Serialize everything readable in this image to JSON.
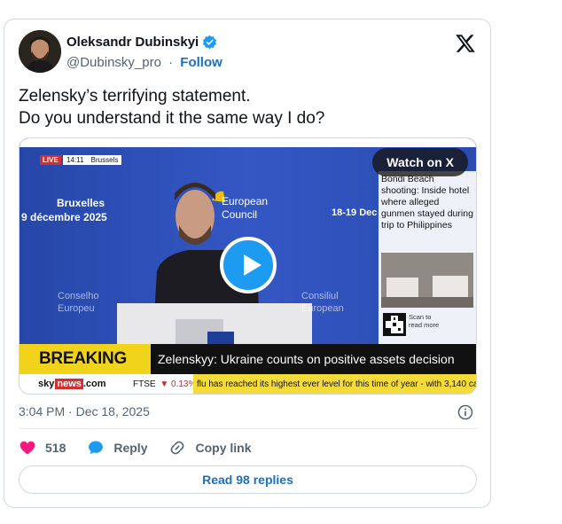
{
  "author": {
    "name": "Oleksandr Dubinskyi",
    "handle": "@Dubinsky_pro",
    "separator": "·",
    "follow_label": "Follow"
  },
  "tweet": {
    "lines": [
      "Zelensky’s terrifying statement.",
      "Do you understand it the same way I do?"
    ],
    "timestamp": "3:04 PM · Dec 18, 2025"
  },
  "media": {
    "watch_label": "Watch on X",
    "live_label": "LIVE",
    "live_time": "14:11",
    "live_location": "Brussels",
    "left_text_1": "Bruxelles",
    "left_text_2": "9 décembre 2025",
    "council_1": "European",
    "council_2": "Council",
    "date_right": "18-19 Dec",
    "consilium_1": "Conselho",
    "consilium_2": "Europeu",
    "consiliul_1": "Consiliul",
    "consiliul_2": "European",
    "side_headline": "Bondi Beach shooting: Inside hotel where alleged gunmen stayed during trip to Philippines",
    "scan_text": "Scan to read more",
    "breaking_label": "BREAKING NEWS",
    "breaking_text": "Zelenskyy: Ukraine counts on positive assets decision",
    "sky_label_1": "sky",
    "sky_label_2": "news",
    "sky_label_3": ".com",
    "ftse_label": "FTSE",
    "ftse_value": "▼ 0.13%",
    "ticker_text": "flu has reached its highest ever level for this time of year - with 3,140 ca"
  },
  "actions": {
    "like_count": "518",
    "reply_label": "Reply",
    "copy_label": "Copy link"
  },
  "read_replies_label": "Read 98 replies",
  "colors": {
    "accent": "#1d9bf0",
    "like": "#f91880",
    "breaking_yellow": "#f2d31b"
  }
}
